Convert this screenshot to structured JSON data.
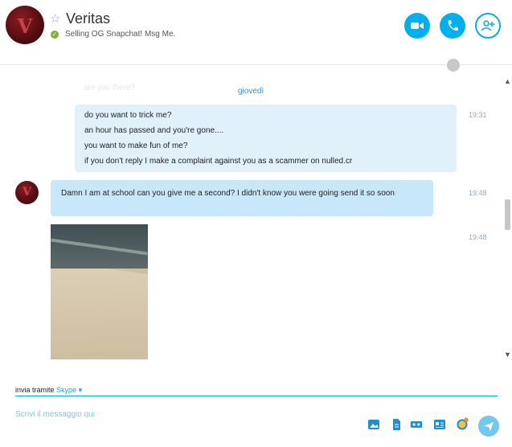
{
  "contact": {
    "name": "Veritas",
    "mood": "Selling OG Snapchat! Msg Me.",
    "avatar_letter": "V"
  },
  "header_actions": [
    {
      "name": "video-call",
      "icon": "video-camera-icon"
    },
    {
      "name": "audio-call",
      "icon": "phone-icon"
    },
    {
      "name": "add-people",
      "icon": "add-person-icon"
    }
  ],
  "conversation": {
    "faded_text": "are you there?",
    "day_separator": "giovedì",
    "outgoing": {
      "lines": [
        "do you want to trick me?",
        "an hour has passed and you're gone....",
        "you want to make fun of me?",
        "if you don't reply I make a complaint against you as a scammer on nulled.cr"
      ],
      "time": "19:31"
    },
    "incoming": {
      "text": "Damn I am at school can you give me a second? I didn't know you were going send it so soon",
      "time": "19:48"
    },
    "photo": {
      "time": "19:48"
    }
  },
  "composer": {
    "send_via_label": "invia tramite",
    "service": "Skype",
    "placeholder": "Scrivi il messaggio qui"
  },
  "colors": {
    "accent": "#00aff0",
    "outgoing_bubble": "#e1f1fa",
    "incoming_bubble": "#c7e8f9",
    "online": "#7bb538"
  }
}
